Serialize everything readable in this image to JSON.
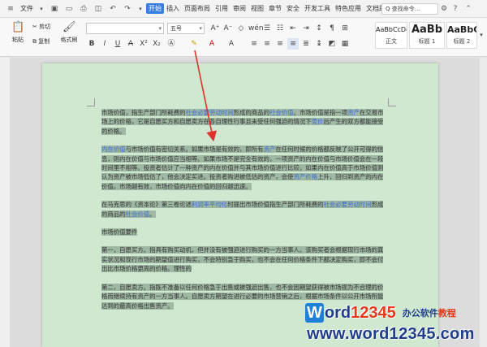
{
  "menubar": {
    "file_label": "文件",
    "tabs": [
      {
        "label": "开始",
        "active": true
      },
      {
        "label": "插入"
      },
      {
        "label": "页面布局"
      },
      {
        "label": "引用"
      },
      {
        "label": "审阅"
      },
      {
        "label": "视图"
      },
      {
        "label": "章节"
      },
      {
        "label": "安全"
      },
      {
        "label": "开发工具"
      },
      {
        "label": "特色应用"
      },
      {
        "label": "文档助手"
      }
    ],
    "search_label": "Q 查找命令..."
  },
  "toolbar": {
    "paste_label": "粘贴",
    "cut_label": "剪切",
    "copy_label": "复制",
    "format_painter_label": "格式刷",
    "font_name": "",
    "font_size": "五号",
    "styles": [
      {
        "sample": "AaBbCcDd",
        "name": "正文"
      },
      {
        "sample": "AaBb",
        "name": "标题 1"
      },
      {
        "sample": "AaBbC",
        "name": "标题 2"
      }
    ]
  },
  "document": {
    "paragraphs": [
      {
        "pre": "市场价值，指生产部门所耗费的",
        "l1": "社会必要劳动时间",
        "mid": "形成的商品的",
        "l2": "社会价值",
        "rest": "。市场价值是指一项",
        "l3": "资产",
        "tail": "在交易市场上的价格，它是自愿买方和自愿卖方在各自理性行事且未受任何强迫的情况下",
        "l4": "竞价",
        "end": "后产生的双方都能接受的价格。"
      },
      {
        "pre": "",
        "l1": "内在价值",
        "mid": "与市场价值有密切关系。如果市场是有效的，即所有",
        "l2": "资产",
        "rest": "在任何时候的价格都反映了公开可得的信息，则内在价值与市场价值应当相等。如果市场不是完全有效的，一项资产的内在价值与市场价值会在一段时间里不相等。投资者估计了一种资产的内在价值并与其市场价值进行比较，如果内在价值高于市场价值则认为资产被市场低估了，他会决定买进。投资者购进被低估的资产，会使",
        "l3": "资产价格",
        "tail": "上升，回归到资产的内在价值。市场越有效，市场价值向内在价值的回归越迅速。",
        "l4": "",
        "end": ""
      },
      {
        "pre": "在马克思的《资本论》第三卷论述",
        "l1": "利润率平均化",
        "mid": "时提出市场价值指生产部门所耗费的",
        "l2": "社会必要劳动时间",
        "rest": "形成的商品的",
        "l3": "社会价值",
        "tail": "。",
        "l4": "",
        "end": ""
      },
      {
        "pre": "市场价值要件",
        "l1": "",
        "mid": "",
        "l2": "",
        "rest": "",
        "l3": "",
        "tail": "",
        "l4": "",
        "end": ""
      },
      {
        "pre": "第一，自愿买方。指具有购买动机，但并没有被强迫进行购买的一方当事人。该购买者会根据现行市场的真实状况和现行市场的期望值进行购买，不会特别急于购买，也不会在任何价格条件下都决定购买，即不会付出比市场价格更高的价格。理性的",
        "l1": "",
        "mid": "",
        "l2": "",
        "rest": "",
        "l3": "",
        "tail": "",
        "l4": "",
        "end": ""
      },
      {
        "pre": "第二，自愿卖方。指既不准备以任何价格急于出售或被强迫出售，也不会因期望获得被市场视为不合理的价格而继续持有资产的一方当事人。自愿卖方期望在进行必要的市场营销之后，根据市场条件以公开市场所能达到的最高价格出售资产。",
        "l1": "",
        "mid": "",
        "l2": "",
        "rest": "",
        "l3": "",
        "tail": "",
        "l4": "",
        "end": ""
      }
    ]
  },
  "watermark": {
    "logo_w": "W",
    "logo_ord": "ord",
    "logo_num": "12345",
    "tag_blue": "办公软件",
    "tag_red": "教程",
    "url": "www.word12345.com"
  },
  "colors": {
    "accent": "#3b7ee1",
    "page_bg": "#cfe8cf",
    "selection": "#9fb8a3",
    "link": "#3a6bd6",
    "arrow": "#e0322b"
  }
}
